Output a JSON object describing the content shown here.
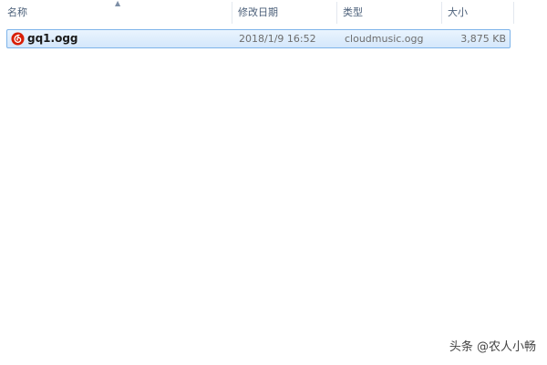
{
  "columns": {
    "name": "名称",
    "modified": "修改日期",
    "type": "类型",
    "size": "大小"
  },
  "sort_indicator": "name-ascending",
  "files": [
    {
      "name": "gq1.ogg",
      "modified": "2018/1/9 16:52",
      "type": "cloudmusic.ogg",
      "size": "3,875 KB",
      "icon": "netease-cloudmusic-icon",
      "selected": true
    }
  ],
  "watermark": "头条 @农人小畅",
  "colors": {
    "selection_border": "#7eb4ea",
    "selection_fill": "#dceafb",
    "header_text": "#4c607a",
    "icon_red": "#d81e06"
  }
}
